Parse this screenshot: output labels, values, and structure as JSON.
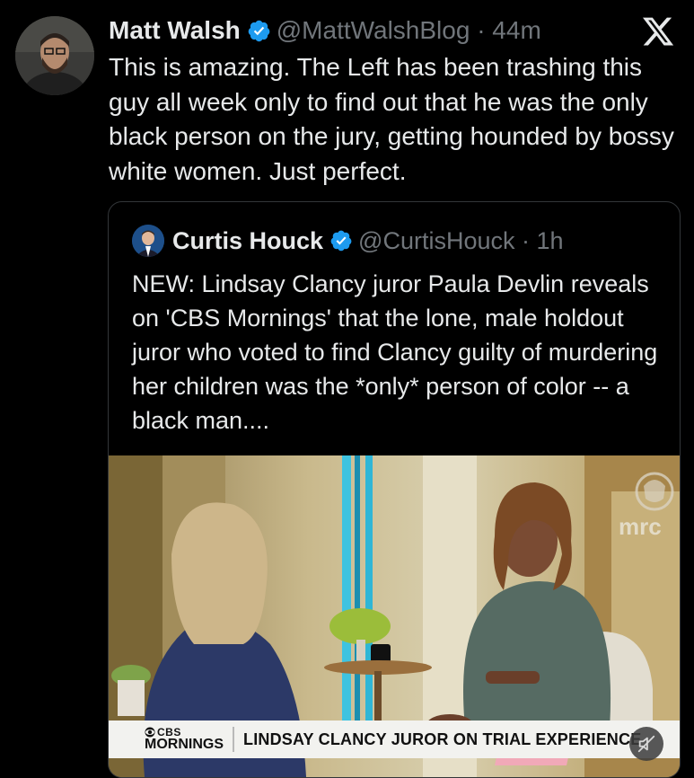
{
  "tweet": {
    "author_name": "Matt Walsh",
    "handle_time": "@MattWalshBlog · 44m",
    "text": "This is amazing. The Left has been trashing this guy all week only to find out that he was the only black person on the jury, getting hounded by bossy white women. Just perfect."
  },
  "quoted_tweet": {
    "author_name": "Curtis Houck",
    "handle_time": "@CurtisHouck · 1h",
    "text": "NEW: Lindsay Clancy juror Paula Devlin reveals on 'CBS Mornings' that the lone, male holdout juror who voted to find Clancy guilty of murdering her children was the *only* person of color -- a black man...."
  },
  "video": {
    "network_top": "CBS",
    "network_bottom": "MORNINGS",
    "chyron": "LINDSAY CLANCY JUROR ON TRIAL EXPERIENCE",
    "watermark": "mrc"
  },
  "icons": {
    "verified": "verified-badge-icon",
    "x_logo": "x-logo-icon",
    "mute": "muted-speaker-icon"
  },
  "colors": {
    "background": "#000000",
    "text": "#e7e9ea",
    "secondary_text": "#71767b",
    "verified_blue": "#1d9bf0",
    "card_border": "#333639"
  }
}
